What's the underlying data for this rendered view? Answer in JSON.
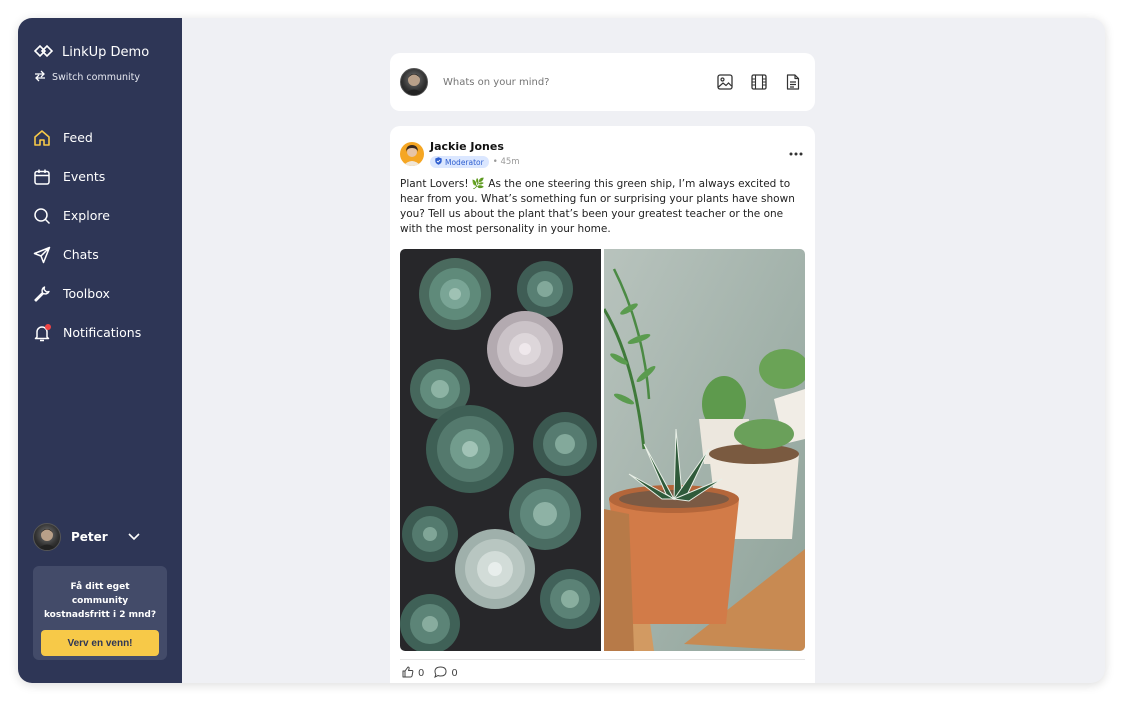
{
  "app": {
    "brand_name": "LinkUp Demo",
    "switch_label": "Switch community"
  },
  "nav": [
    {
      "label": "Feed",
      "icon": "home-icon",
      "active": true
    },
    {
      "label": "Events",
      "icon": "calendar-icon"
    },
    {
      "label": "Explore",
      "icon": "search-icon"
    },
    {
      "label": "Chats",
      "icon": "send-icon"
    },
    {
      "label": "Toolbox",
      "icon": "wrench-icon"
    },
    {
      "label": "Notifications",
      "icon": "bell-icon",
      "has_dot": true
    }
  ],
  "user": {
    "name": "Peter"
  },
  "promo": {
    "text": "Få ditt eget community kostnadsfritt i 2 mnd?",
    "button": "Verv en venn!"
  },
  "composer": {
    "placeholder": "Whats on your mind?"
  },
  "post": {
    "author": "Jackie Jones",
    "badge": "Moderator",
    "time": "• 45m",
    "text": "Plant Lovers! 🌿 As the one steering this green ship, I’m always excited to hear from you. What’s something fun or surprising your plants have shown you? Tell us about the plant that’s been your greatest teacher or the one with the most personality in your home.",
    "likes": "0",
    "comments": "0"
  },
  "colors": {
    "sidebar": "#2e3656",
    "accent": "#f7c948",
    "background": "#eff0f4"
  }
}
